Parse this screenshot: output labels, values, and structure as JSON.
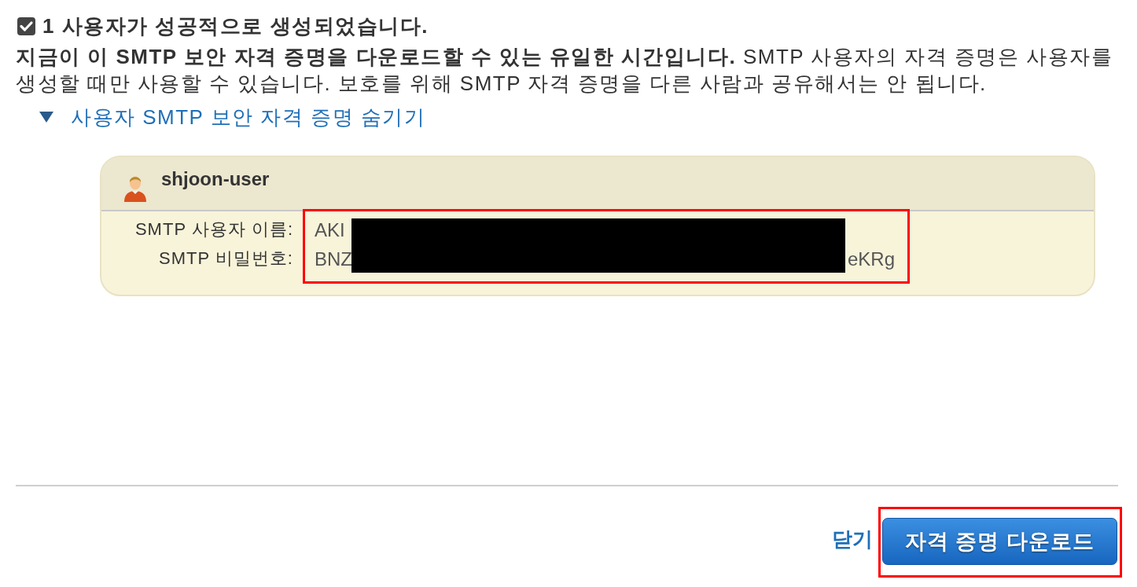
{
  "notice": {
    "checked": true,
    "title": "1 사용자가 성공적으로 생성되었습니다."
  },
  "message": "**지금이 이 SMTP 보안 자격 증명을 다운로드할 수 있는 유일한 시간입니다.** SMTP 사용자의 자격 증명은 사용자를 생성할 때만 사용할 수 있습니다. 보호를 위해 SMTP 자격 증명을 다른 사람과 공유해서는 안 됩니다.",
  "toggle": {
    "label": "사용자 SMTP 보안 자격 증명 숨기기",
    "expanded": true
  },
  "user_card": {
    "name": "shjoon-user",
    "highlighted": true,
    "redacted": true,
    "fields": [
      {
        "label": "SMTP 사용자 이름:",
        "value_start": "AKI"
      },
      {
        "label": "SMTP 비밀번호:",
        "value_start": "BNZ",
        "value_end": "eKRg"
      }
    ]
  },
  "actions": {
    "close": "닫기",
    "download": {
      "label": "자격 증명 다운로드",
      "highlighted": true
    }
  }
}
